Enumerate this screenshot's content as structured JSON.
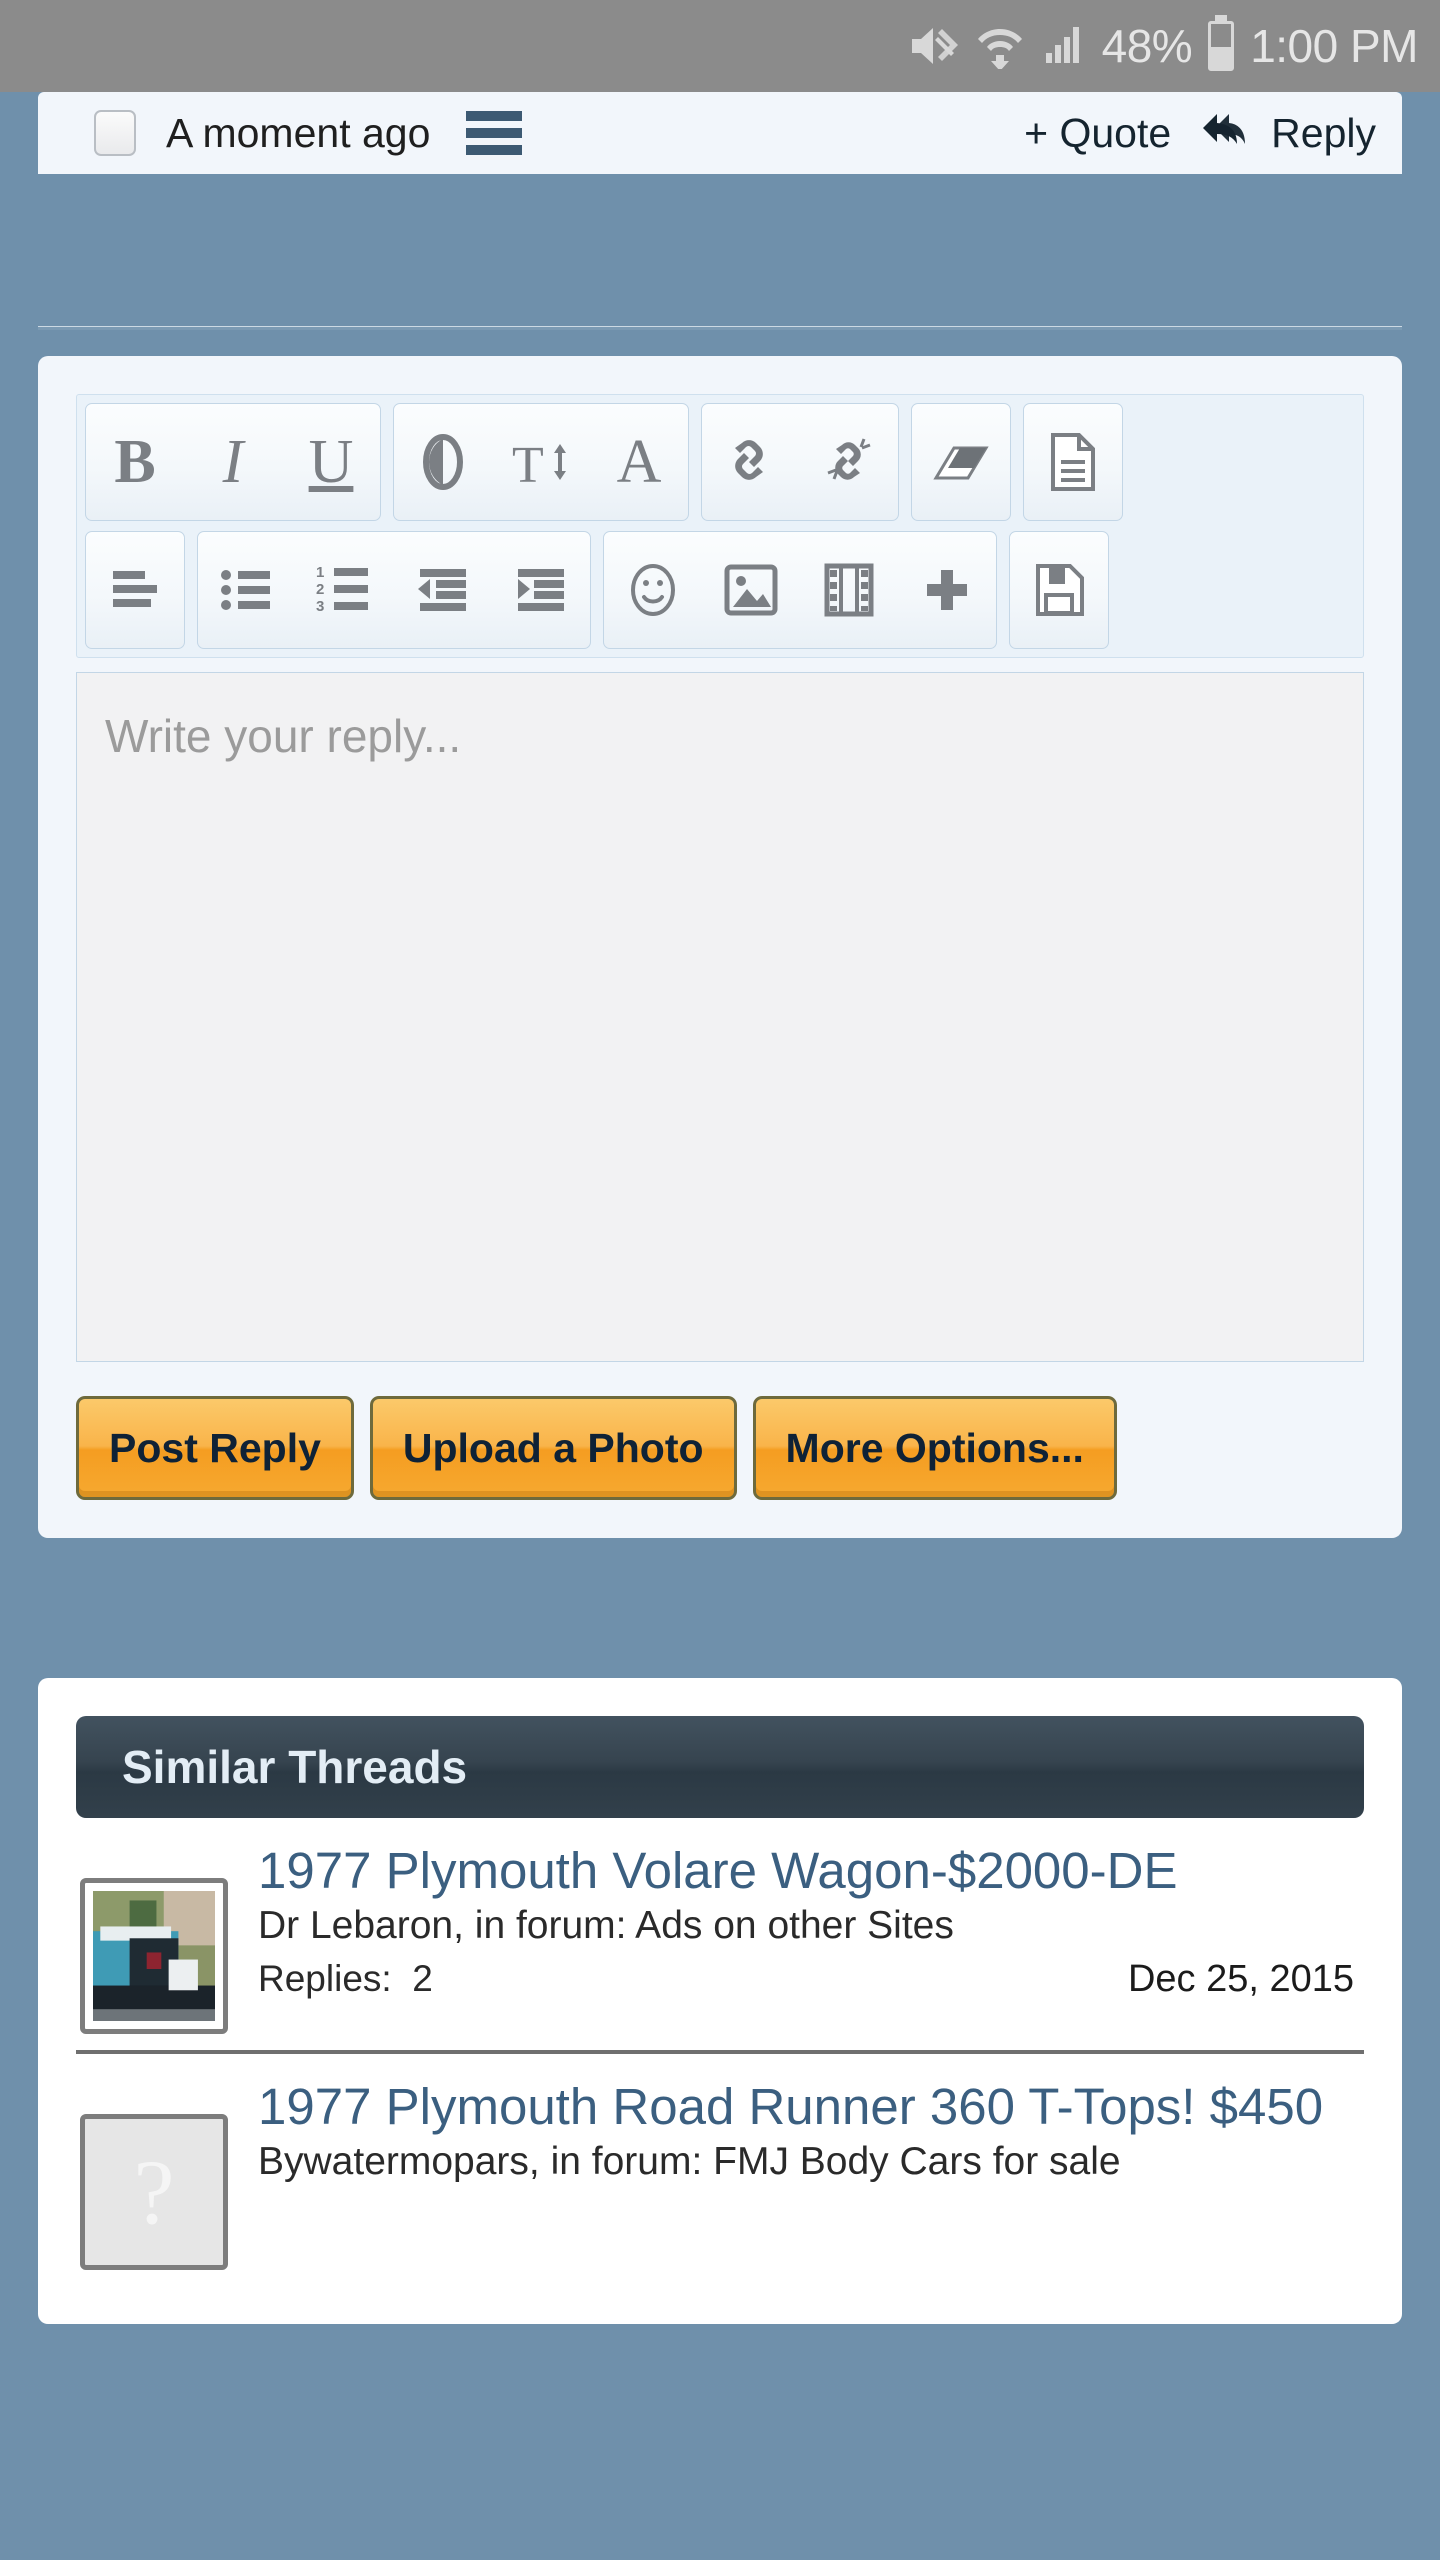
{
  "statusbar": {
    "mute_icon": "mute-icon",
    "wifi_icon": "wifi-icon",
    "signal_icon": "cell-signal-icon",
    "battery_percent": "48%",
    "battery_icon": "battery-icon",
    "time": "1:00 PM"
  },
  "post_footer": {
    "checkbox_name": "post-select-checkbox",
    "timestamp": "A moment ago",
    "menu_icon": "hamburger-menu-icon",
    "quote_label": "+ Quote",
    "reply_label": "Reply",
    "reply_icon": "reply-arrow-icon"
  },
  "editor": {
    "placeholder": "Write your reply...",
    "toolbar_rows": [
      {
        "groups": [
          {
            "buttons": [
              {
                "name": "bold-button",
                "glyph": "B",
                "style": "b"
              },
              {
                "name": "italic-button",
                "glyph": "I",
                "style": "i"
              },
              {
                "name": "underline-button",
                "glyph": "U",
                "style": "u"
              }
            ]
          },
          {
            "buttons": [
              {
                "name": "text-color-icon",
                "glyph": "",
                "style": "svg-contrast"
              },
              {
                "name": "font-size-icon",
                "glyph": "",
                "style": "svg-fontsize"
              },
              {
                "name": "font-family-icon",
                "glyph": "A",
                "style": "serif"
              }
            ]
          },
          {
            "buttons": [
              {
                "name": "insert-link-icon",
                "glyph": "",
                "style": "svg-link"
              },
              {
                "name": "unlink-icon",
                "glyph": "",
                "style": "svg-unlink"
              }
            ]
          },
          {
            "buttons": [
              {
                "name": "remove-formatting-eraser-icon",
                "glyph": "",
                "style": "svg-eraser"
              }
            ]
          },
          {
            "buttons": [
              {
                "name": "source-document-icon",
                "glyph": "",
                "style": "svg-doc"
              }
            ]
          }
        ]
      },
      {
        "groups": [
          {
            "buttons": [
              {
                "name": "align-left-icon",
                "glyph": "",
                "style": "svg-align"
              }
            ]
          },
          {
            "buttons": [
              {
                "name": "bullet-list-icon",
                "glyph": "",
                "style": "svg-ul"
              },
              {
                "name": "numbered-list-icon",
                "glyph": "",
                "style": "svg-ol"
              },
              {
                "name": "outdent-icon",
                "glyph": "",
                "style": "svg-outdent"
              },
              {
                "name": "indent-icon",
                "glyph": "",
                "style": "svg-indent"
              }
            ]
          },
          {
            "buttons": [
              {
                "name": "emoji-smiley-icon",
                "glyph": "",
                "style": "svg-smiley"
              },
              {
                "name": "insert-image-icon",
                "glyph": "",
                "style": "svg-image"
              },
              {
                "name": "insert-media-film-icon",
                "glyph": "",
                "style": "svg-film"
              },
              {
                "name": "more-insert-plus-icon",
                "glyph": "",
                "style": "svg-plus"
              }
            ]
          },
          {
            "buttons": [
              {
                "name": "save-draft-floppy-icon",
                "glyph": "",
                "style": "svg-floppy"
              }
            ]
          }
        ]
      }
    ],
    "buttons": [
      {
        "name": "post-reply-button",
        "label": "Post Reply"
      },
      {
        "name": "upload-photo-button",
        "label": "Upload a Photo"
      },
      {
        "name": "more-options-button",
        "label": "More Options..."
      }
    ]
  },
  "similar_threads": {
    "header": "Similar Threads",
    "items": [
      {
        "title": "1977 Plymouth Volare Wagon-$2000-DE",
        "meta": "Dr Lebaron, in forum: Ads on other Sites",
        "replies_label": "Replies:",
        "replies_count": "2",
        "date": "Dec 25, 2015",
        "thumb_kind": "photo"
      },
      {
        "title": "1977 Plymouth Road Runner 360 T-Tops! $450",
        "meta": "Bywatermopars, in forum: FMJ Body Cars for sale",
        "replies_label": "",
        "replies_count": "",
        "date": "",
        "thumb_kind": "placeholder",
        "thumb_glyph": "?"
      }
    ]
  },
  "colors": {
    "page_bg": "#6f90ab",
    "panel_bg": "#f2f6fb",
    "accent_orange": "#f6a930",
    "link_blue": "#3b5f80",
    "header_dark": "#2b3944"
  }
}
